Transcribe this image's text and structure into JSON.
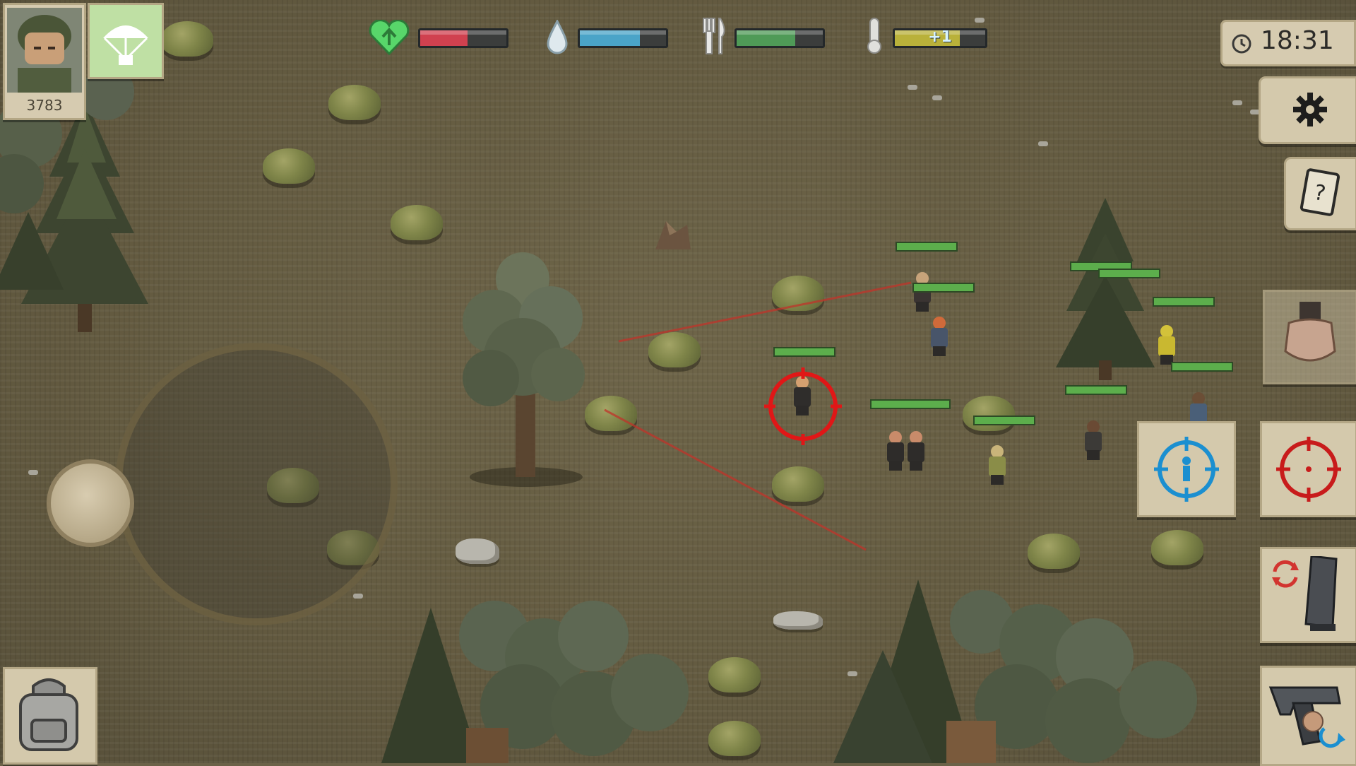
{
  "hud": {
    "player": {
      "score": "3783"
    },
    "stats": {
      "health": {
        "level": 0.55,
        "color": "#d0414f"
      },
      "thirst": {
        "level": 0.7,
        "color": "#4aa4c8"
      },
      "hunger": {
        "level": 0.68,
        "color": "#4f9a57"
      },
      "temperature": {
        "level": 0.72,
        "color": "#b9b13a",
        "label": "+1"
      }
    },
    "clock": {
      "time": "18:31"
    }
  },
  "icons": {
    "settings": "gear-icon",
    "journal": "journal-icon",
    "melee": "fist-icon",
    "target_friendly": "friendly-target-icon",
    "target_enemy": "enemy-target-icon",
    "reload": "reload-icon",
    "weapon": "pistol-icon",
    "airdrop": "parachute-icon",
    "inventory": "backpack-icon"
  },
  "colors": {
    "crosshair": "#e01717",
    "friendly_target": "#1b8fd0",
    "laser": "#c0342a",
    "enemy_health": "#5cae4c"
  }
}
